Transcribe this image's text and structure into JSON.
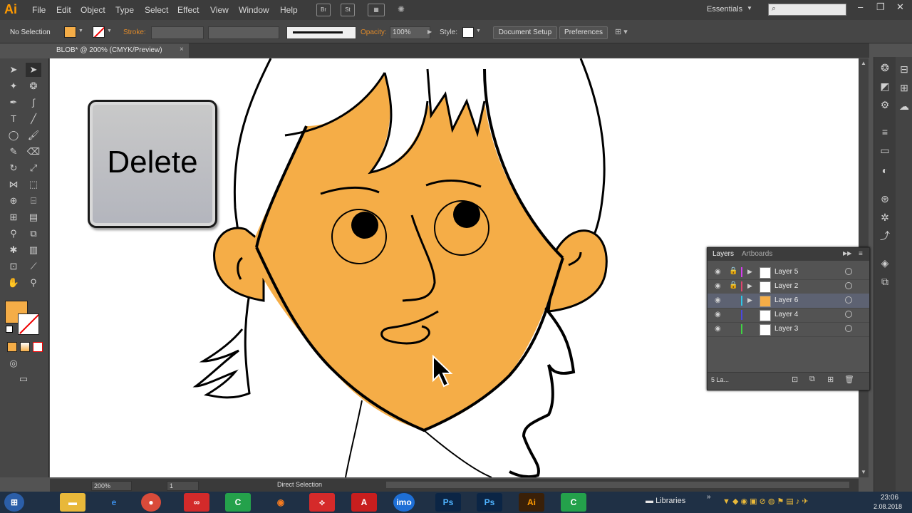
{
  "app": {
    "logo": "Ai"
  },
  "menu": [
    "File",
    "Edit",
    "Object",
    "Type",
    "Select",
    "Effect",
    "View",
    "Window",
    "Help"
  ],
  "menu_buttons": [
    "Br",
    "St"
  ],
  "workspace": "Essentials",
  "control_bar": {
    "selection": "No Selection",
    "stroke_label": "Stroke:",
    "opacity_label": "Opacity:",
    "opacity_value": "100%",
    "style_label": "Style:",
    "document_setup": "Document Setup",
    "preferences": "Preferences"
  },
  "document_tab": {
    "title": "BLOB* @ 200% (CMYK/Preview)",
    "close": "×"
  },
  "overlay_key": {
    "label": "Delete"
  },
  "colors": {
    "fill": "#f5ad47",
    "accent": "#ff9a00"
  },
  "layers_panel": {
    "tabs": [
      "Layers",
      "Artboards"
    ],
    "layers": [
      {
        "name": "Layer 5",
        "color": "#d63cf0",
        "locked": true,
        "selected": false
      },
      {
        "name": "Layer 2",
        "color": "#e0446f",
        "locked": true,
        "selected": false
      },
      {
        "name": "Layer 6",
        "color": "#2ec8e8",
        "locked": false,
        "selected": true
      },
      {
        "name": "Layer 4",
        "color": "#4b48e0",
        "locked": false,
        "selected": false
      },
      {
        "name": "Layer 3",
        "color": "#3fd443",
        "locked": false,
        "selected": false
      }
    ],
    "footer_count": "5 La..."
  },
  "status_bar": {
    "zoom": "200%",
    "artboard": "1",
    "tool": "Direct Selection"
  },
  "taskbar": {
    "libraries": "Libraries",
    "time": "23:06",
    "date": "2.08.2018"
  }
}
